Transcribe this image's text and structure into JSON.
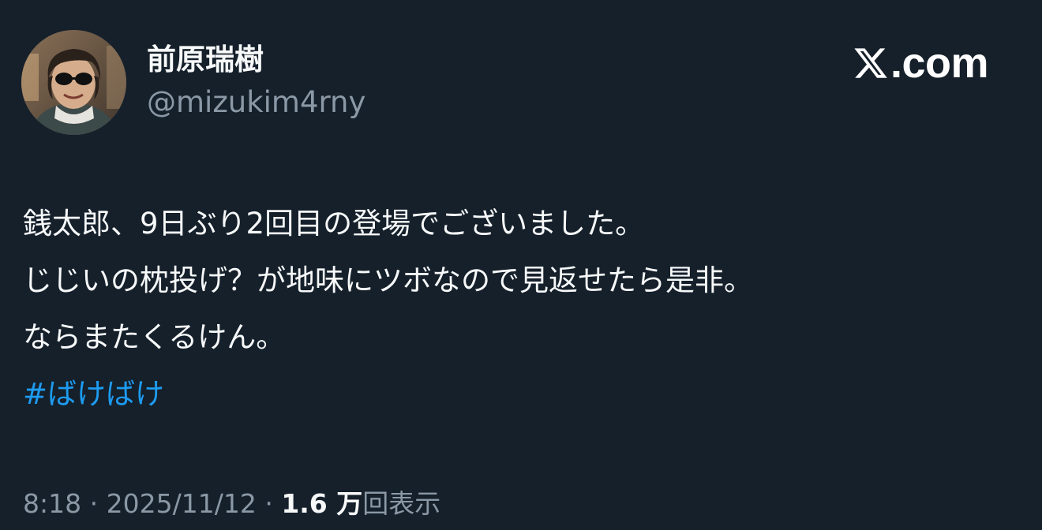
{
  "author": {
    "display_name": "前原瑞樹",
    "handle": "@mizukim4rny"
  },
  "brand": {
    "icon": "x-logo-icon",
    "text": ".com"
  },
  "tweet": {
    "lines": [
      "銭太郎、9日ぶり2回目の登場でございました。",
      "じじいの枕投げ？が地味にツボなので見返せたら是非。",
      "ならまたくるけん。"
    ],
    "hashtag": "#ばけばけ"
  },
  "meta": {
    "time": "8:18",
    "separator": "·",
    "date": "2025/11/12",
    "views_count": "1.6 万",
    "views_label": "回表示"
  },
  "colors": {
    "background": "#15202b",
    "text_primary": "#f7f9f9",
    "text_secondary": "#8b98a5",
    "link": "#1d9bf0"
  }
}
